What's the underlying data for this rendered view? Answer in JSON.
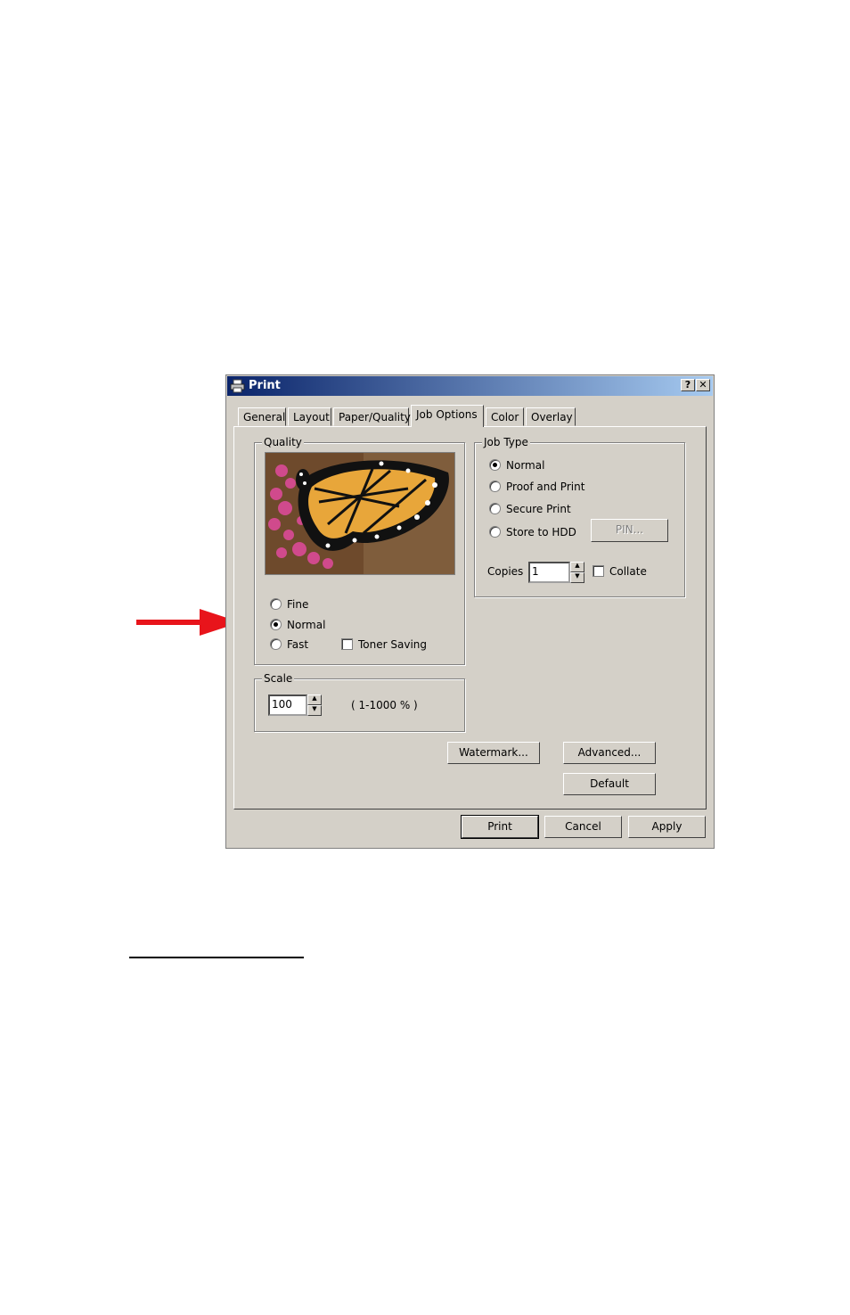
{
  "dialog": {
    "title": "Print",
    "help_button": "?",
    "close_button": "✕",
    "tabs": [
      "General",
      "Layout",
      "Paper/Quality",
      "Job Options",
      "Color",
      "Overlay"
    ],
    "active_tab": "Job Options"
  },
  "quality": {
    "label": "Quality",
    "options": [
      "Fine",
      "Normal",
      "Fast"
    ],
    "selected": "Normal",
    "toner_saving": "Toner Saving"
  },
  "job_type": {
    "label": "Job Type",
    "options": [
      "Normal",
      "Proof and Print",
      "Secure Print",
      "Store to HDD"
    ],
    "selected": "Normal",
    "pin_button": "PIN...",
    "copies_label": "Copies",
    "copies_value": "1",
    "collate": "Collate"
  },
  "scale": {
    "label": "Scale",
    "value": "100",
    "range": "( 1-1000 % )"
  },
  "buttons": {
    "watermark": "Watermark...",
    "advanced": "Advanced...",
    "default": "Default",
    "print": "Print",
    "cancel": "Cancel",
    "apply": "Apply"
  },
  "colors": {
    "arrow": "#e8141b",
    "titlebar_start": "#0a246a",
    "titlebar_end": "#a6caf0",
    "dialog_bg": "#d4d0c8"
  }
}
